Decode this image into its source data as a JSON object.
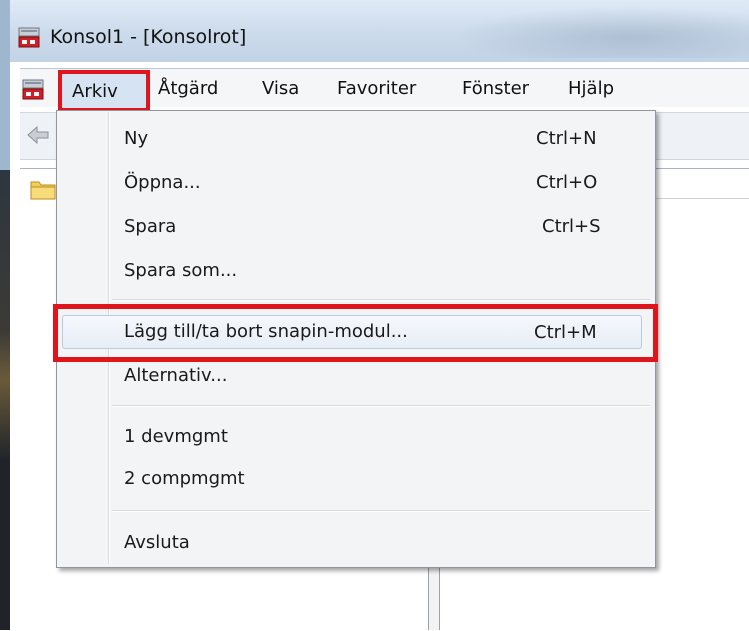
{
  "window": {
    "title": "Konsol1 - [Konsolrot]"
  },
  "menubar": {
    "items": [
      {
        "label": "Arkiv"
      },
      {
        "label": "Åtgärd"
      },
      {
        "label": "Visa"
      },
      {
        "label": "Favoriter"
      },
      {
        "label": "Fönster"
      },
      {
        "label": "Hjälp"
      }
    ]
  },
  "file_menu": {
    "items": [
      {
        "label": "Ny",
        "shortcut": "Ctrl+N"
      },
      {
        "label": "Öppna...",
        "shortcut": "Ctrl+O"
      },
      {
        "label": "Spara",
        "shortcut": "Ctrl+S"
      },
      {
        "label": "Spara som...",
        "shortcut": ""
      },
      {
        "label": "Lägg till/ta bort snapin-modul...",
        "shortcut": "Ctrl+M"
      },
      {
        "label": "Alternativ...",
        "shortcut": ""
      },
      {
        "label": "1 devmgmt",
        "shortcut": ""
      },
      {
        "label": "2 compmgmt",
        "shortcut": ""
      },
      {
        "label": "Avsluta",
        "shortcut": ""
      }
    ]
  },
  "colors": {
    "highlight_box": "#e0151b",
    "menu_background": "#f2f4f6",
    "hover_border": "#b7cbe2"
  }
}
